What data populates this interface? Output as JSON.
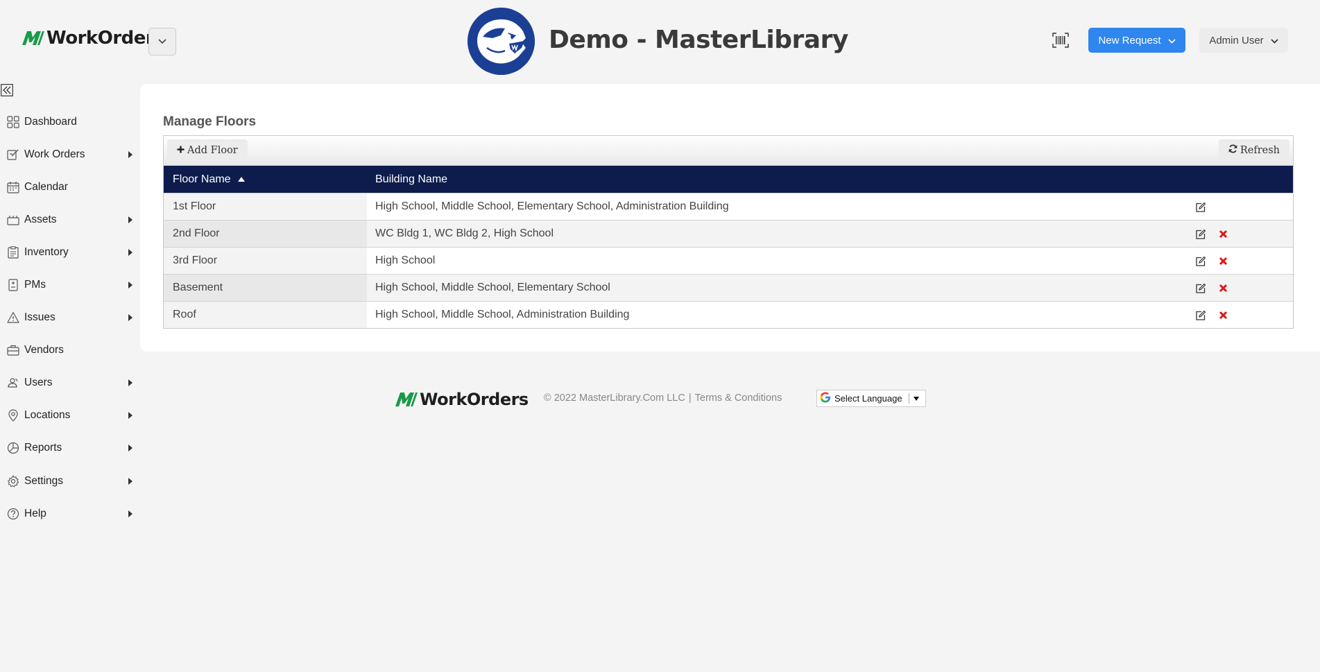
{
  "header": {
    "logo_text": "WorkOrders",
    "site_title": "Demo - MasterLibrary",
    "new_request_label": "New Request",
    "user_label": "Admin User",
    "brand_color": "#1a9a49",
    "primary_button_color": "#2f86ee"
  },
  "sidebar": {
    "items": [
      {
        "label": "Dashboard",
        "icon": "dashboard-icon",
        "has_submenu": false
      },
      {
        "label": "Work Orders",
        "icon": "work-orders-icon",
        "has_submenu": true
      },
      {
        "label": "Calendar",
        "icon": "calendar-icon",
        "has_submenu": false
      },
      {
        "label": "Assets",
        "icon": "assets-icon",
        "has_submenu": true
      },
      {
        "label": "Inventory",
        "icon": "inventory-icon",
        "has_submenu": true
      },
      {
        "label": "PMs",
        "icon": "pms-icon",
        "has_submenu": true
      },
      {
        "label": "Issues",
        "icon": "warning-icon",
        "has_submenu": true
      },
      {
        "label": "Vendors",
        "icon": "briefcase-icon",
        "has_submenu": false
      },
      {
        "label": "Users",
        "icon": "users-icon",
        "has_submenu": true
      },
      {
        "label": "Locations",
        "icon": "location-pin-icon",
        "has_submenu": true
      },
      {
        "label": "Reports",
        "icon": "reports-icon",
        "has_submenu": true
      },
      {
        "label": "Settings",
        "icon": "gear-icon",
        "has_submenu": true
      },
      {
        "label": "Help",
        "icon": "help-icon",
        "has_submenu": true
      }
    ]
  },
  "main": {
    "title": "Manage Floors",
    "toolbar": {
      "add_label": "Add Floor",
      "refresh_label": "Refresh"
    },
    "columns": [
      "Floor Name",
      "Building Name"
    ],
    "sort": {
      "column": "Floor Name",
      "direction": "ascending"
    },
    "header_color": "#0d1c4c",
    "rows": [
      {
        "floor": "1st Floor",
        "buildings": "High School, Middle School, Elementary School, Administration Building",
        "deletable": false
      },
      {
        "floor": "2nd Floor",
        "buildings": "WC Bldg 1, WC Bldg 2, High School",
        "deletable": true
      },
      {
        "floor": "3rd Floor",
        "buildings": "High School",
        "deletable": true
      },
      {
        "floor": "Basement",
        "buildings": "High School, Middle School, Elementary School",
        "deletable": true
      },
      {
        "floor": "Roof",
        "buildings": "High School, Middle School, Administration Building",
        "deletable": true
      }
    ]
  },
  "footer": {
    "logo_text": "WorkOrders",
    "copyright": "© 2022 MasterLibrary.Com LLC",
    "separator": "|",
    "terms_label": "Terms & Conditions",
    "language_label": "Select Language"
  }
}
